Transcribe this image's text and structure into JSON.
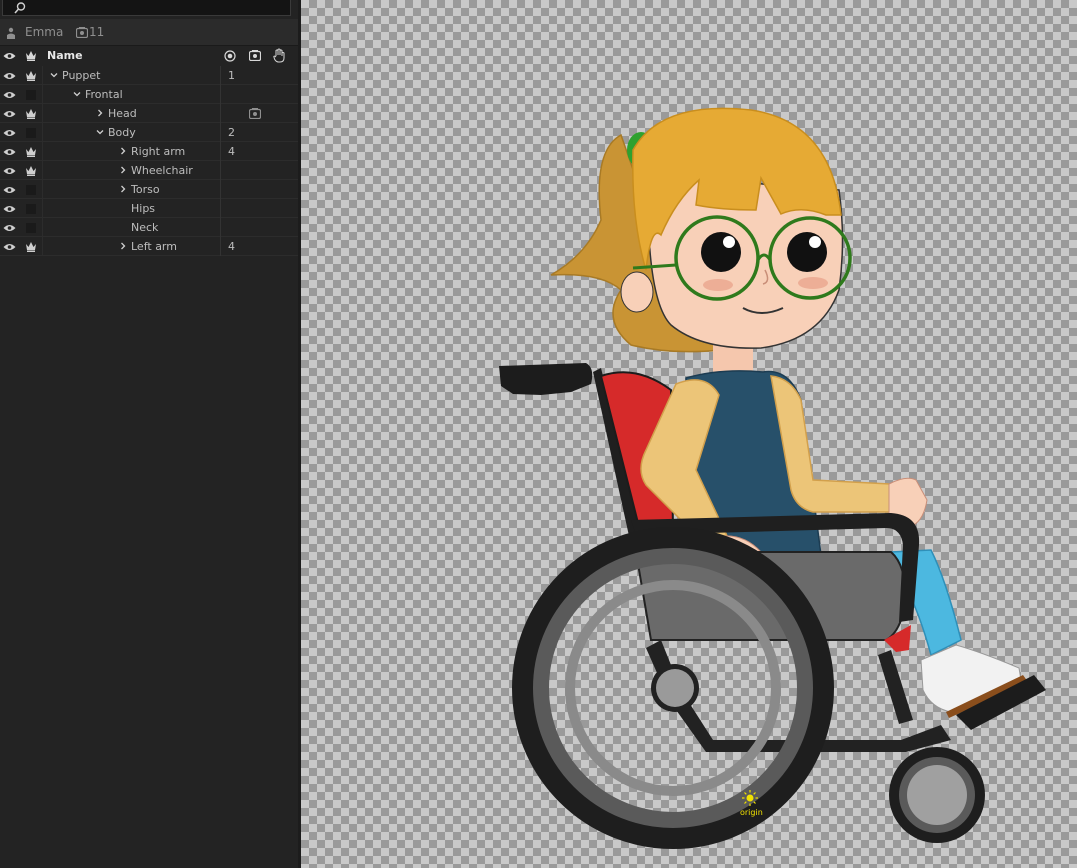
{
  "puppet_bar": {
    "name": "Emma",
    "count": "11"
  },
  "columns": {
    "name": "Name"
  },
  "rows": [
    {
      "label": "Puppet",
      "num": "1"
    },
    {
      "label": "Frontal",
      "num": ""
    },
    {
      "label": "Head",
      "num": ""
    },
    {
      "label": "Body",
      "num": "2"
    },
    {
      "label": "Right arm",
      "num": "4"
    },
    {
      "label": "Wheelchair",
      "num": ""
    },
    {
      "label": "Torso",
      "num": ""
    },
    {
      "label": "Hips",
      "num": ""
    },
    {
      "label": "Neck",
      "num": ""
    },
    {
      "label": "Left arm",
      "num": "4"
    }
  ],
  "canvas": {
    "origin_label": "origin"
  },
  "colors": {
    "panel_bg": "#232323",
    "origin_marker": "#f2e200"
  },
  "icons": [
    "search-icon",
    "person-icon",
    "camera-icon",
    "eye-icon",
    "crown-icon",
    "target-icon",
    "hand-icon",
    "chevron-right-icon",
    "chevron-down-icon",
    "sun-icon"
  ]
}
